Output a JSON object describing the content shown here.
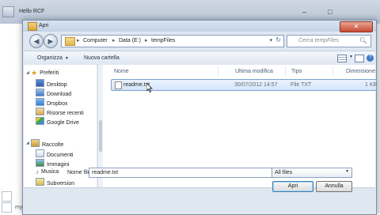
{
  "background_app": {
    "title": "Hello RCF",
    "controls": [
      "–",
      "□"
    ],
    "left_text": "my"
  },
  "dialog": {
    "title": "Apri",
    "close_glyph": "✕",
    "nav": {
      "back_glyph": "◀",
      "forward_glyph": "▶"
    },
    "address": {
      "separator": "▸",
      "segments": [
        "Computer",
        "Data (E:)",
        "tempFiles"
      ],
      "dropdown_glyph": "▾",
      "refresh_glyph": "↻"
    },
    "search": {
      "placeholder": "Cerca tempFiles",
      "icon": "search-icon"
    },
    "toolbar": {
      "organize_label": "Organizza",
      "organize_caret": "▼",
      "new_folder_label": "Nuova cartella",
      "help_glyph": "?"
    },
    "navigation": {
      "favorites_label": "Preferiti",
      "favorites": [
        "Desktop",
        "Download",
        "Dropbox",
        "Risorse recenti",
        "Google Drive"
      ],
      "libraries_label": "Raccolte",
      "libraries": [
        "Documenti",
        "Immagini",
        "Musica",
        "Subversion"
      ],
      "star_glyph": "★",
      "music_glyph": "♪",
      "expand_glyph": "◢"
    },
    "file_list": {
      "columns": [
        "Nome",
        "Ultima modifica",
        "Tipo",
        "Dimensione"
      ],
      "rows": [
        {
          "name": "readme.txt",
          "modified": "30/07/2012 14:57",
          "type": "File TXT",
          "size": "1 KB"
        }
      ]
    },
    "footer": {
      "filename_label": "Nome file:",
      "filename_value": "readme.txt",
      "filetype_value": "All files",
      "dropdown_glyph": "▼",
      "open_label": "Apri",
      "cancel_label": "Annulla"
    }
  },
  "colors": {
    "accent": "#3e79c8",
    "selection": "#d4e6fb",
    "close_button": "#c74b33"
  }
}
